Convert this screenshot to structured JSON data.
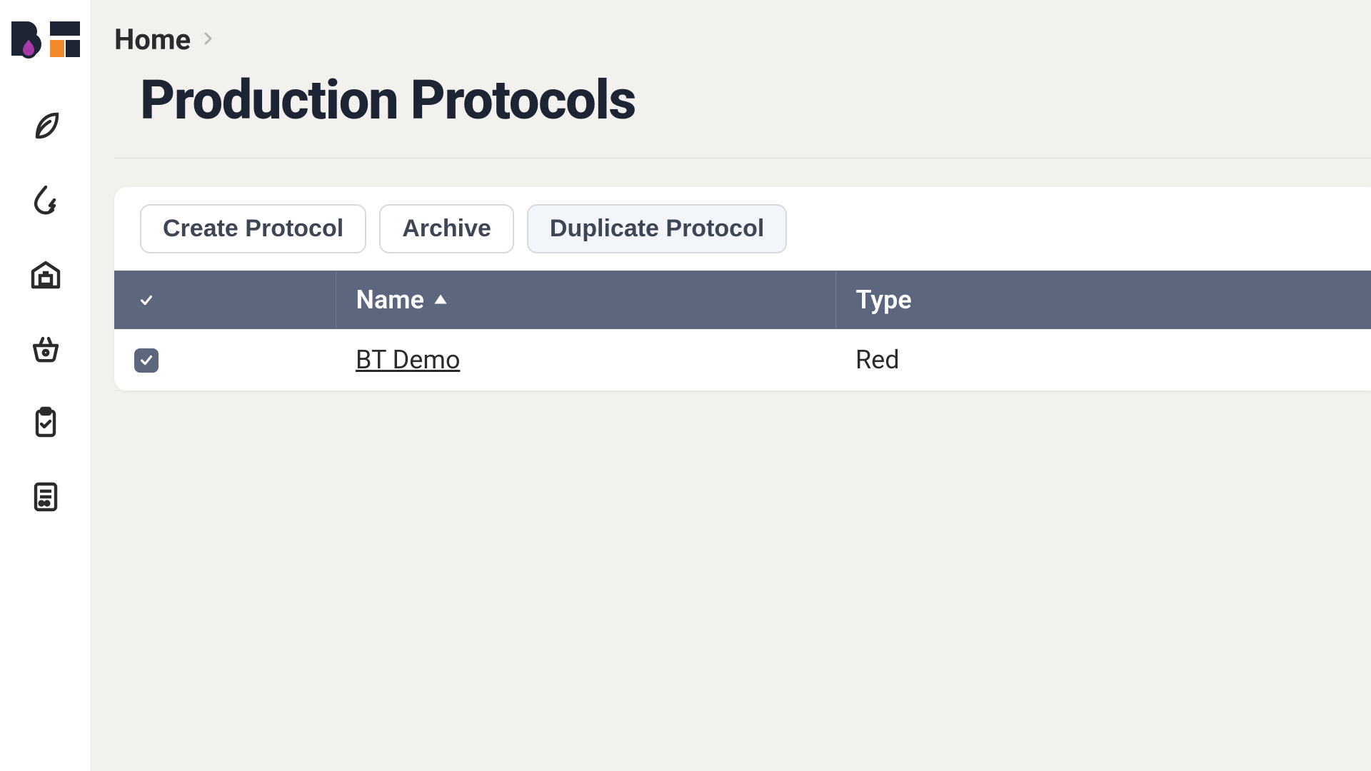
{
  "breadcrumb": {
    "home": "Home"
  },
  "page": {
    "title": "Production Protocols"
  },
  "toolbar": {
    "create": "Create Protocol",
    "archive": "Archive",
    "duplicate": "Duplicate Protocol"
  },
  "table": {
    "columns": {
      "name": "Name",
      "type": "Type"
    },
    "rows": [
      {
        "name": "BT Demo",
        "type": "Red",
        "checked": true
      }
    ],
    "header_checked": true
  },
  "nav_icons": [
    "leaf-icon",
    "drop-bolt-icon",
    "warehouse-icon",
    "basket-icon",
    "clipboard-check-icon",
    "report-icon"
  ]
}
